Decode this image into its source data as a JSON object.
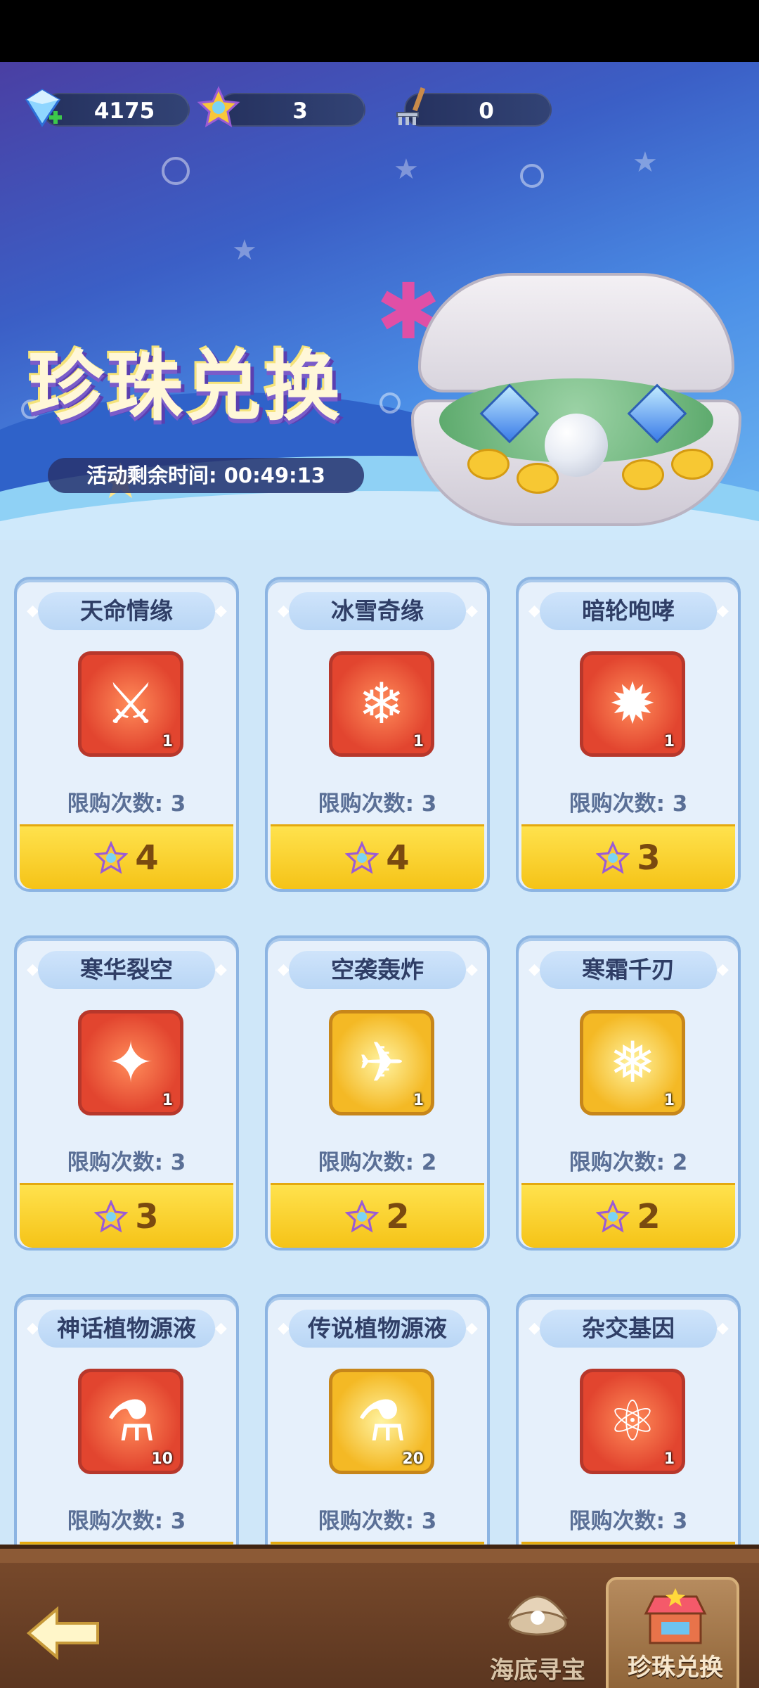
{
  "resources": {
    "diamond": {
      "icon": "diamond-plus-icon",
      "value": "4175"
    },
    "star_coin": {
      "icon": "star-coin-icon",
      "value": "3"
    },
    "rake": {
      "icon": "rake-icon",
      "value": "0"
    }
  },
  "banner": {
    "title": "珍珠兑换",
    "timer_label": "活动剩余时间:",
    "timer_value": "00:49:13"
  },
  "items": [
    {
      "name": "天命情缘",
      "qty": "1",
      "limit": "限购次数: 3",
      "price": "4",
      "frame": "red",
      "icon": "armor-icon"
    },
    {
      "name": "冰雪奇缘",
      "qty": "1",
      "limit": "限购次数: 3",
      "price": "4",
      "frame": "red",
      "icon": "ice-armor-icon"
    },
    {
      "name": "暗轮咆哮",
      "qty": "1",
      "limit": "限购次数: 3",
      "price": "3",
      "frame": "red",
      "icon": "flame-cannon-icon"
    },
    {
      "name": "寒华裂空",
      "qty": "1",
      "limit": "限购次数: 3",
      "price": "3",
      "frame": "red",
      "icon": "frost-blaster-icon"
    },
    {
      "name": "空袭轰炸",
      "qty": "1",
      "limit": "限购次数: 2",
      "price": "2",
      "frame": "gold",
      "icon": "airstrike-card-icon"
    },
    {
      "name": "寒霜千刃",
      "qty": "1",
      "limit": "限购次数: 2",
      "price": "2",
      "frame": "gold",
      "icon": "frost-blades-card-icon"
    },
    {
      "name": "神话植物源液",
      "qty": "10",
      "limit": "限购次数: 3",
      "price": "",
      "frame": "red",
      "icon": "red-potion-icon"
    },
    {
      "name": "传说植物源液",
      "qty": "20",
      "limit": "限购次数: 3",
      "price": "",
      "frame": "gold",
      "icon": "orange-potion-icon"
    },
    {
      "name": "杂交基因",
      "qty": "1",
      "limit": "限购次数: 3",
      "price": "",
      "frame": "red",
      "icon": "gene-capsule-icon"
    }
  ],
  "nav": {
    "back_icon": "back-arrow-icon",
    "tabs": [
      {
        "label": "海底寻宝",
        "icon": "shell-treasure-icon",
        "active": false
      },
      {
        "label": "珍珠兑换",
        "icon": "shop-stall-icon",
        "active": true
      }
    ]
  },
  "colors": {
    "accent": "#f5c317",
    "card_bg": "#e6f0fb",
    "nav_bg": "#5b3620"
  }
}
